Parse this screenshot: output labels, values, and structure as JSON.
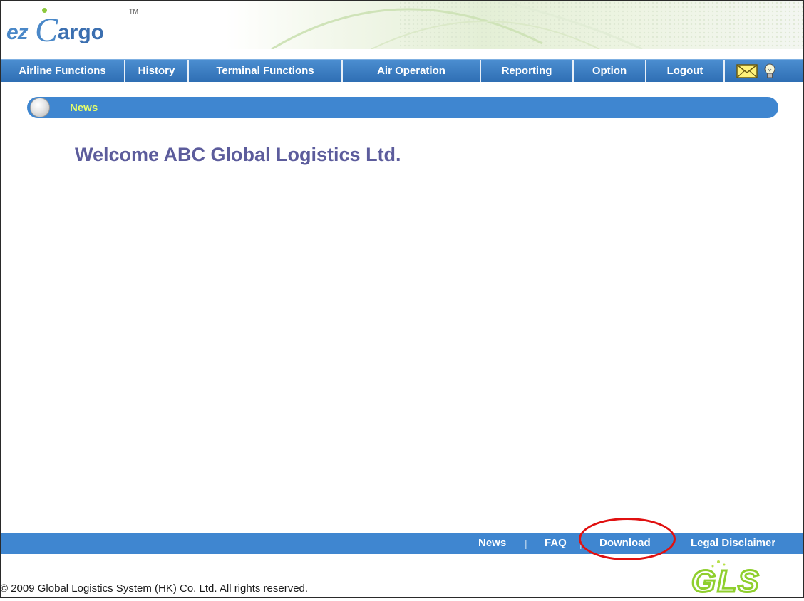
{
  "app": {
    "logo_ez": "ez",
    "logo_c": "C",
    "logo_argo": "argo",
    "logo_tm": "TM"
  },
  "nav": {
    "items": [
      {
        "label": "Airline Functions"
      },
      {
        "label": "History"
      },
      {
        "label": "Terminal Functions"
      },
      {
        "label": "Air Operation"
      },
      {
        "label": "Reporting"
      },
      {
        "label": "Option"
      },
      {
        "label": "Logout"
      }
    ],
    "icons": [
      "mail-icon",
      "lightbulb-icon"
    ]
  },
  "news": {
    "title": "News",
    "icon": "globe-icon"
  },
  "main": {
    "welcome": "Welcome ABC Global Logistics Ltd."
  },
  "footer": {
    "links": [
      {
        "label": "News"
      },
      {
        "label": "FAQ"
      },
      {
        "label": "Download"
      },
      {
        "label": "Legal Disclaimer"
      }
    ],
    "separator": "|",
    "copyright": "© 2009 Global Logistics System (HK) Co. Ltd. All rights reserved.",
    "logo_text": "GLS"
  },
  "colors": {
    "nav_blue": "#3f86d0",
    "news_title": "#e8ff6a",
    "welcome_text": "#5c5c9c",
    "highlight": "#e01010"
  }
}
